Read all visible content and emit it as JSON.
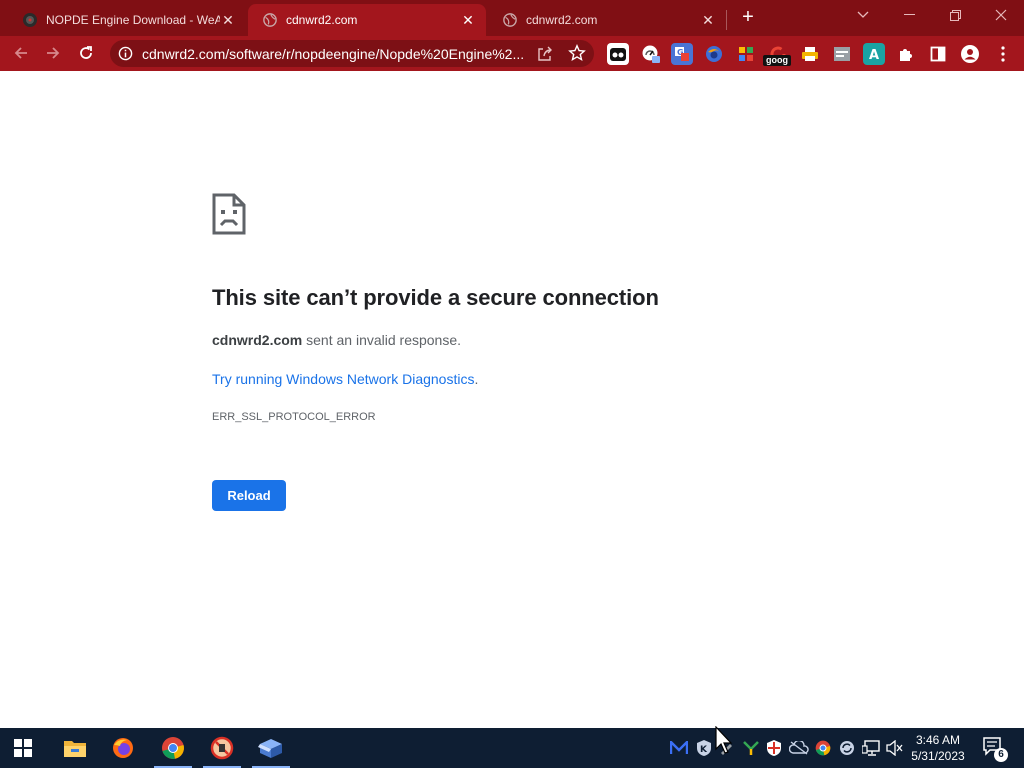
{
  "browser": {
    "tabs": [
      {
        "title": "NOPDE Engine Download - WeA",
        "favicon": "wea-icon",
        "active": false
      },
      {
        "title": "cdnwrd2.com",
        "favicon": "globe-icon",
        "active": true
      },
      {
        "title": "cdnwrd2.com",
        "favicon": "globe-icon",
        "active": false
      }
    ],
    "new_tab_label": "+",
    "address_bar": {
      "url": "cdnwrd2.com/software/r/nopdeengine/Nopde%20Engine%2..."
    },
    "extension_badge": "goog",
    "theme_colors": {
      "tabstrip": "#800f14",
      "toolbar": "#a3161d",
      "omnibox": "#7d1015"
    }
  },
  "error_page": {
    "heading": "This site can’t provide a secure connection",
    "host": "cdnwrd2.com",
    "message": " sent an invalid response.",
    "suggestion_link": "Try running Windows Network Diagnostics",
    "suggestion_suffix": ".",
    "error_code": "ERR_SSL_PROTOCOL_ERROR",
    "reload_label": "Reload",
    "accent_color": "#1a73e8"
  },
  "taskbar": {
    "pinned": [
      "windows-start-icon",
      "file-explorer-icon",
      "firefox-icon",
      "chrome-icon",
      "blocked-app-icon",
      "box-app-icon"
    ],
    "clock": {
      "time": "3:46 AM",
      "date": "5/31/2023"
    },
    "notification_count": "6"
  }
}
